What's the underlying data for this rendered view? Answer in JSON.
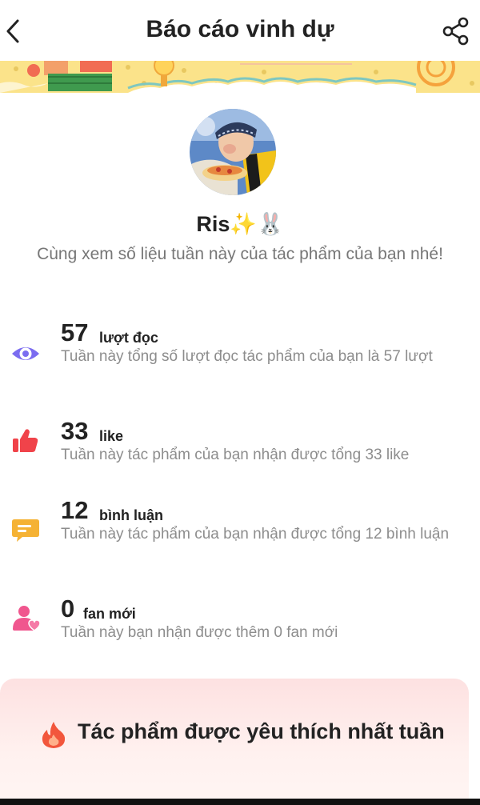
{
  "header": {
    "title": "Báo cáo vinh dự"
  },
  "profile": {
    "username": "Ris✨🐰",
    "subtitle": "Cùng xem số liệu tuần này của tác phẩm của bạn nhé!"
  },
  "stats": [
    {
      "value": "57",
      "unit": "lượt đọc",
      "description": "Tuần này tổng số lượt đọc tác phẩm của bạn là 57 lượt",
      "icon": "eye-icon",
      "color": "#7b6cf0"
    },
    {
      "value": "33",
      "unit": "like",
      "description": "Tuần này tác phẩm của bạn nhận được tổng 33 like",
      "icon": "thumbs-up-icon",
      "color": "#f0434a"
    },
    {
      "value": "12",
      "unit": "bình luận",
      "description": "Tuần này tác phẩm của bạn nhận được tổng 12 bình luận",
      "icon": "comment-icon",
      "color": "#f5b234"
    },
    {
      "value": "0",
      "unit": "fan mới",
      "description": "Tuần này bạn nhận được thêm 0 fan mới",
      "icon": "fan-icon",
      "color": "#f0568e"
    }
  ],
  "favorite": {
    "title": "Tác phẩm được yêu thích nhất tuần",
    "icon": "fire-icon"
  },
  "colors": {
    "banner": "#fbe38a",
    "card": "#fde1e1",
    "muted_text": "#8d8d8d"
  }
}
